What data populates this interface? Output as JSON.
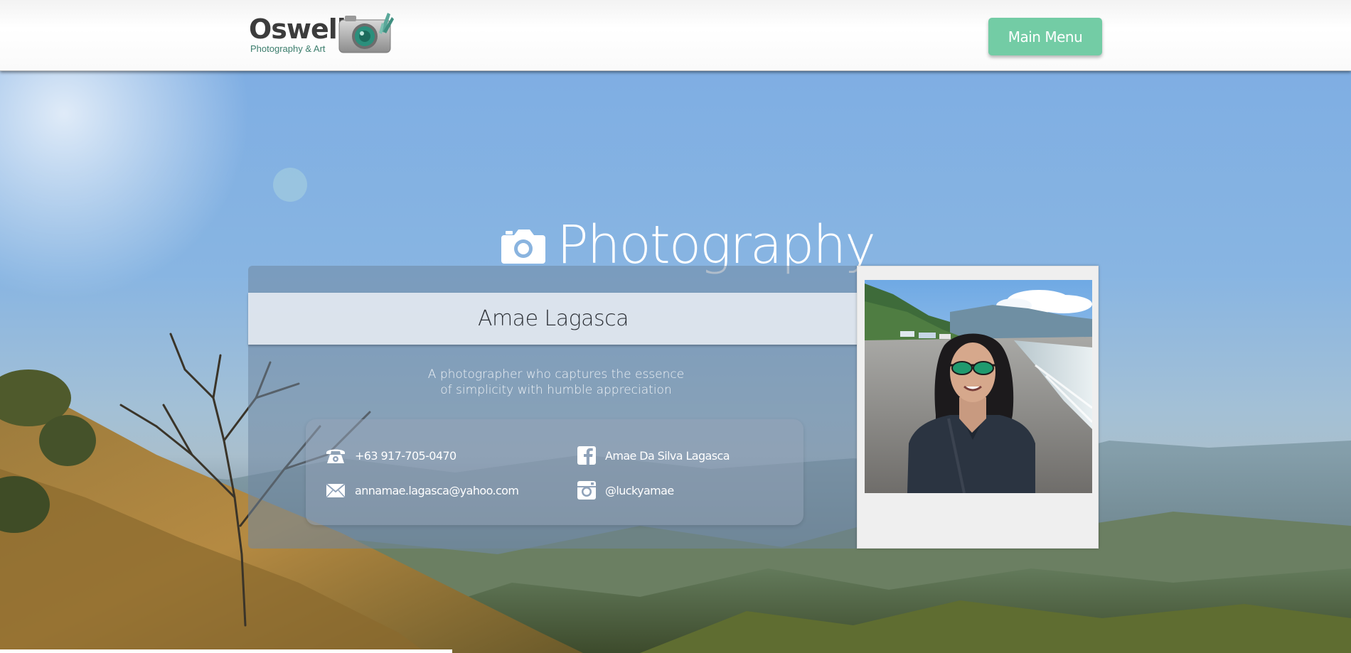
{
  "header": {
    "logo_word": "Oswell",
    "logo_sub": "Photography & Art",
    "menu_label": "Main Menu"
  },
  "hero": {
    "title": "Photography",
    "title_icon": "camera-icon"
  },
  "profile": {
    "name": "Amae Lagasca",
    "tagline_line1": "A photographer who captures the essence",
    "tagline_line2": "of simplicity with humble appreciation",
    "contacts": {
      "phone": {
        "icon": "phone-icon",
        "text": "+63 917-705-0470"
      },
      "facebook": {
        "icon": "facebook-icon",
        "text": "Amae Da Silva Lagasca"
      },
      "email": {
        "icon": "envelope-icon",
        "text": "annamae.lagasca@yahoo.com"
      },
      "instagram": {
        "icon": "instagram-icon",
        "text": "@luckyamae"
      }
    }
  },
  "colors": {
    "accent": "#73cca5",
    "logo_sub": "#3b7d6c",
    "sky": "#7faee3"
  }
}
